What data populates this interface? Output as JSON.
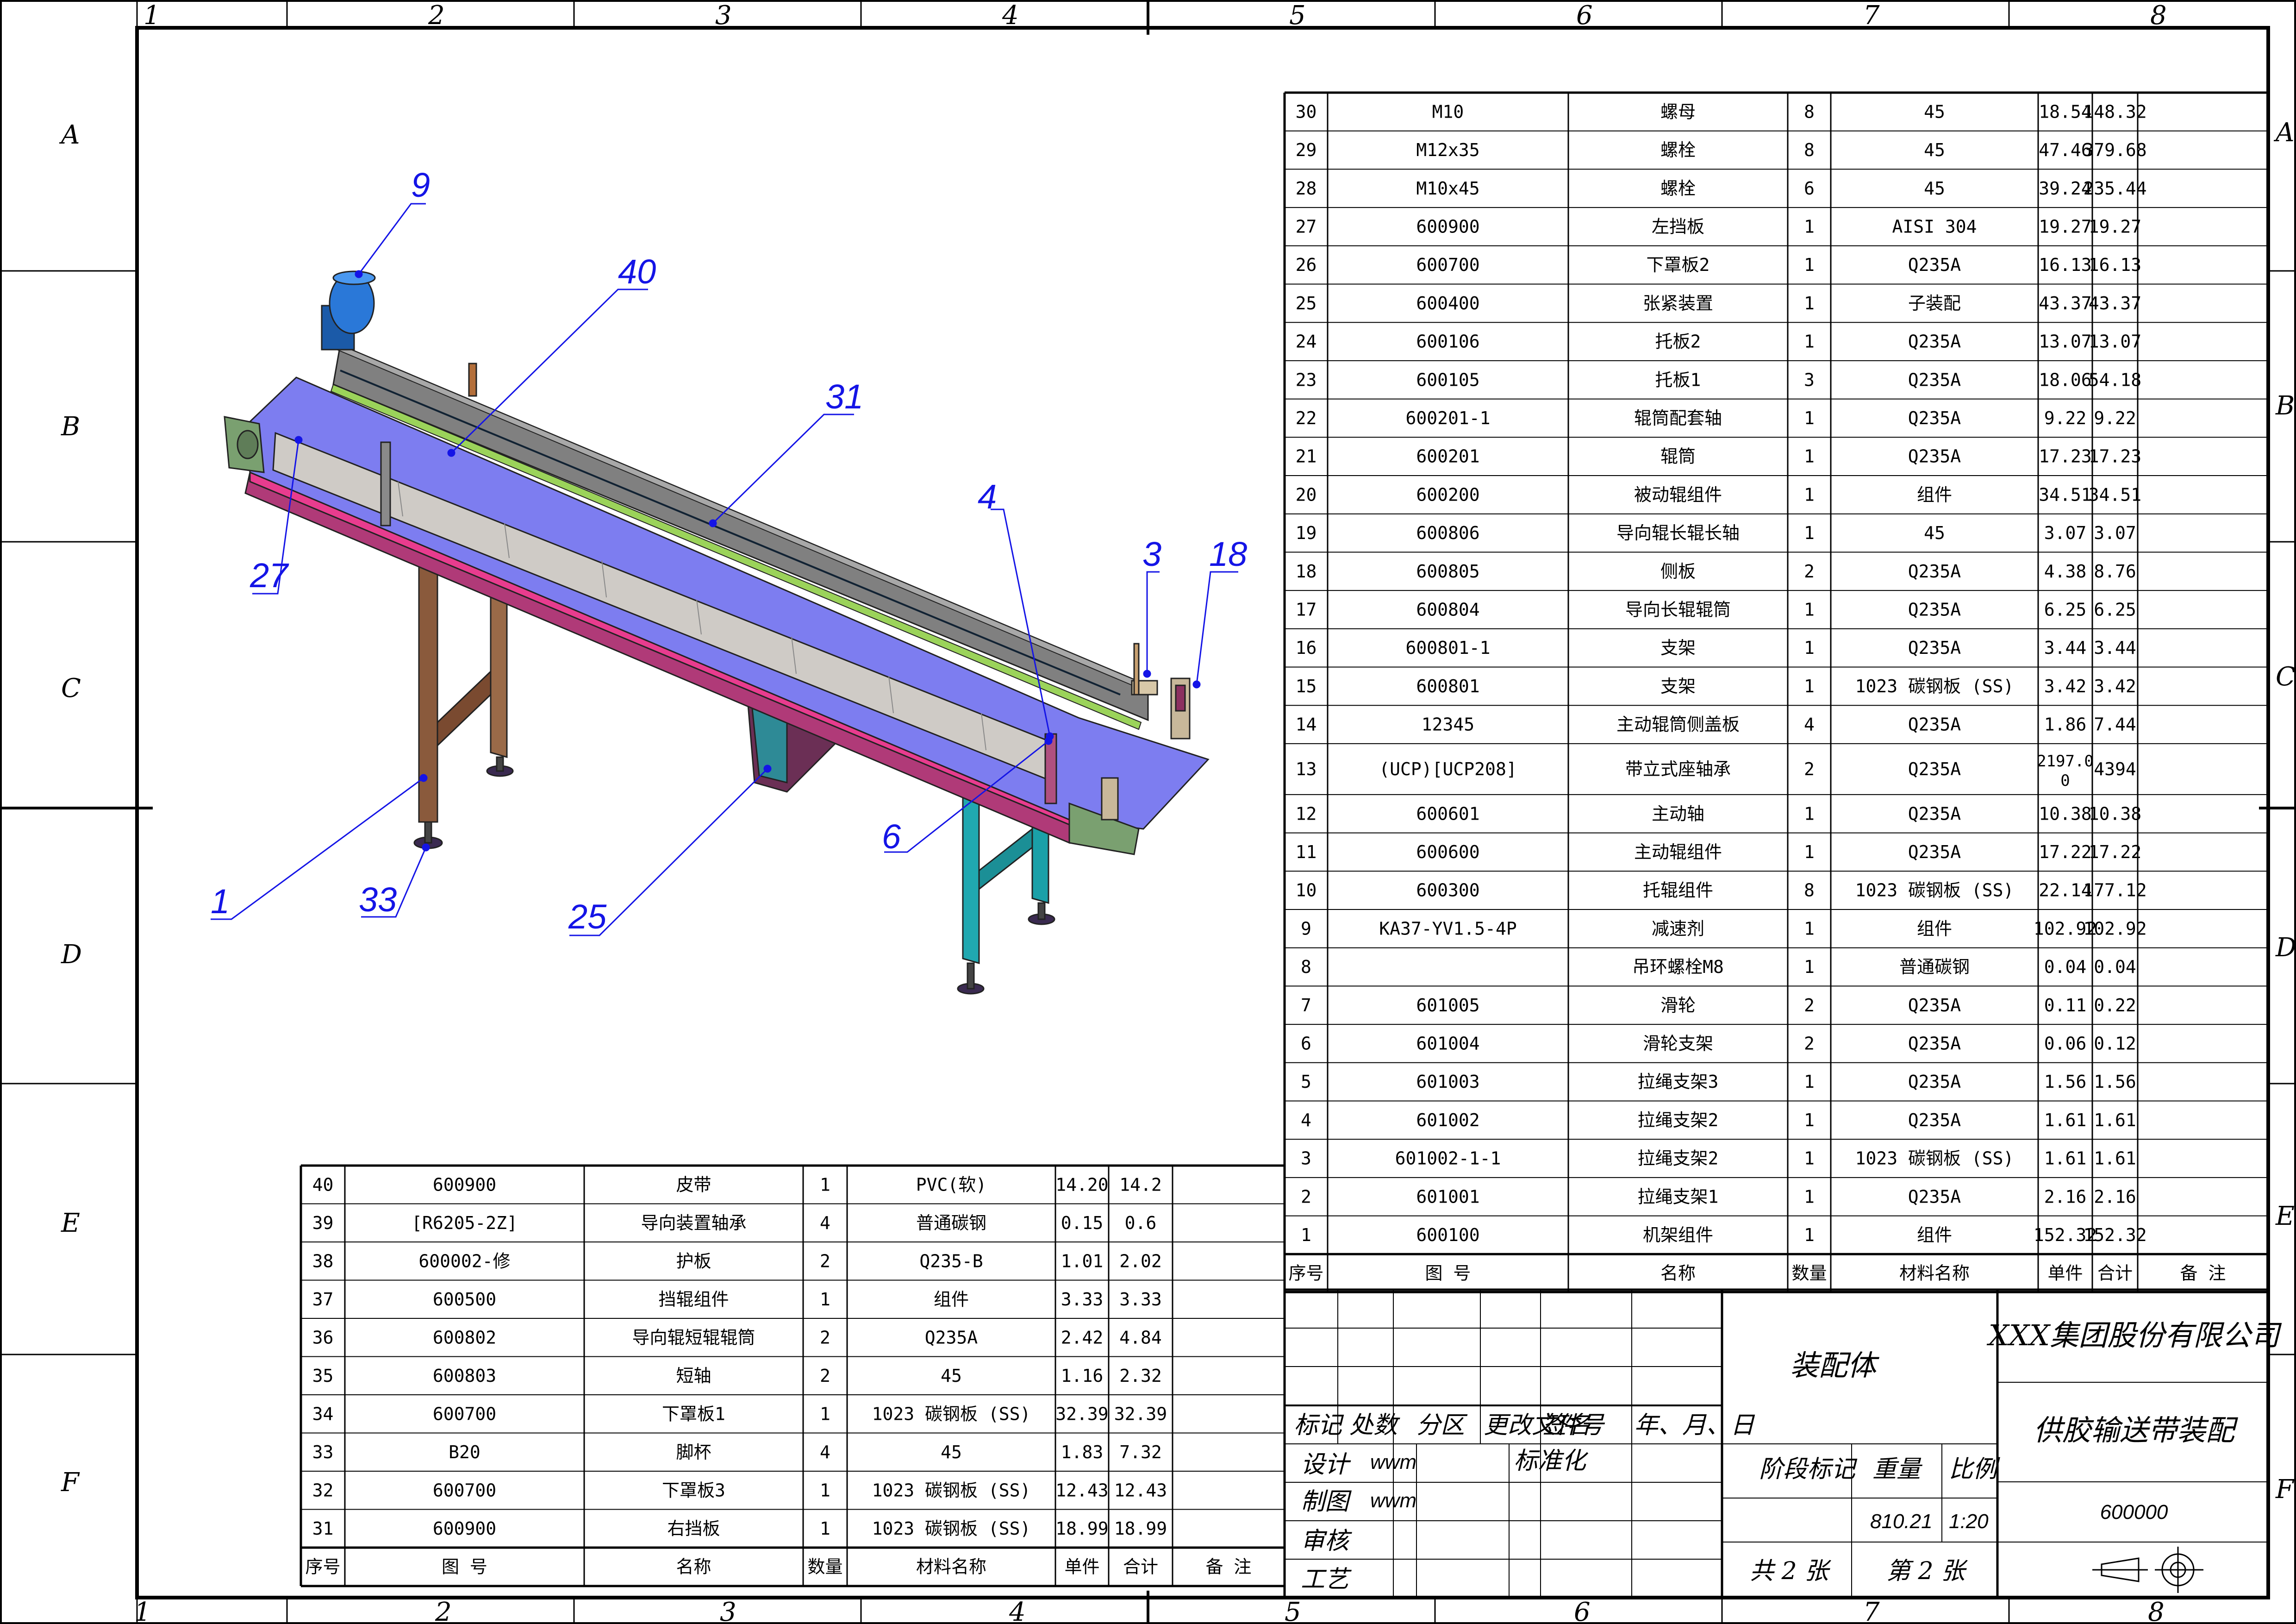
{
  "zones": {
    "columns": [
      "1",
      "2",
      "3",
      "4",
      "5",
      "6",
      "7",
      "8"
    ],
    "rows": [
      "A",
      "B",
      "C",
      "D",
      "E",
      "F"
    ]
  },
  "balloons": [
    "9",
    "40",
    "31",
    "27",
    "4",
    "3",
    "18",
    "6",
    "1",
    "33",
    "25"
  ],
  "bom_headers": {
    "no": "序号",
    "code": "图 号",
    "name": "名称",
    "qty": "数量",
    "material": "材料名称",
    "unit": "单件",
    "total": "合计",
    "remark": "备 注"
  },
  "bom_right": [
    {
      "no": "30",
      "code": "M10",
      "name": "螺母",
      "qty": "8",
      "material": "45",
      "unit": "18.54",
      "total": "148.32"
    },
    {
      "no": "29",
      "code": "M12x35",
      "name": "螺栓",
      "qty": "8",
      "material": "45",
      "unit": "47.46",
      "total": "379.68"
    },
    {
      "no": "28",
      "code": "M10x45",
      "name": "螺栓",
      "qty": "6",
      "material": "45",
      "unit": "39.24",
      "total": "235.44"
    },
    {
      "no": "27",
      "code": "600900",
      "name": "左挡板",
      "qty": "1",
      "material": "AISI 304",
      "unit": "19.27",
      "total": "19.27"
    },
    {
      "no": "26",
      "code": "600700",
      "name": "下罩板2",
      "qty": "1",
      "material": "Q235A",
      "unit": "16.13",
      "total": "16.13"
    },
    {
      "no": "25",
      "code": "600400",
      "name": "张紧装置",
      "qty": "1",
      "material": "子装配",
      "unit": "43.37",
      "total": "43.37"
    },
    {
      "no": "24",
      "code": "600106",
      "name": "托板2",
      "qty": "1",
      "material": "Q235A",
      "unit": "13.07",
      "total": "13.07"
    },
    {
      "no": "23",
      "code": "600105",
      "name": "托板1",
      "qty": "3",
      "material": "Q235A",
      "unit": "18.06",
      "total": "54.18"
    },
    {
      "no": "22",
      "code": "600201-1",
      "name": "辊筒配套轴",
      "qty": "1",
      "material": "Q235A",
      "unit": "9.22",
      "total": "9.22"
    },
    {
      "no": "21",
      "code": "600201",
      "name": "辊筒",
      "qty": "1",
      "material": "Q235A",
      "unit": "17.23",
      "total": "17.23"
    },
    {
      "no": "20",
      "code": "600200",
      "name": "被动辊组件",
      "qty": "1",
      "material": "组件",
      "unit": "34.51",
      "total": "34.51"
    },
    {
      "no": "19",
      "code": "600806",
      "name": "导向辊长辊长轴",
      "qty": "1",
      "material": "45",
      "unit": "3.07",
      "total": "3.07"
    },
    {
      "no": "18",
      "code": "600805",
      "name": "侧板",
      "qty": "2",
      "material": "Q235A",
      "unit": "4.38",
      "total": "8.76"
    },
    {
      "no": "17",
      "code": "600804",
      "name": "导向长辊辊筒",
      "qty": "1",
      "material": "Q235A",
      "unit": "6.25",
      "total": "6.25"
    },
    {
      "no": "16",
      "code": "600801-1",
      "name": "支架",
      "qty": "1",
      "material": "Q235A",
      "unit": "3.44",
      "total": "3.44"
    },
    {
      "no": "15",
      "code": "600801",
      "name": "支架",
      "qty": "1",
      "material": "1023 碳钢板 (SS)",
      "unit": "3.42",
      "total": "3.42"
    },
    {
      "no": "14",
      "code": "12345",
      "name": "主动辊筒侧盖板",
      "qty": "4",
      "material": "Q235A",
      "unit": "1.86",
      "total": "7.44"
    },
    {
      "no": "13",
      "code": "(UCP)[UCP208]",
      "name": "带立式座轴承",
      "qty": "2",
      "material": "Q235A",
      "unit": "2197.0",
      "unit2": "0",
      "total": "4394"
    },
    {
      "no": "12",
      "code": "600601",
      "name": "主动轴",
      "qty": "1",
      "material": "Q235A",
      "unit": "10.38",
      "total": "10.38"
    },
    {
      "no": "11",
      "code": "600600",
      "name": "主动辊组件",
      "qty": "1",
      "material": "Q235A",
      "unit": "17.22",
      "total": "17.22"
    },
    {
      "no": "10",
      "code": "600300",
      "name": "托辊组件",
      "qty": "8",
      "material": "1023 碳钢板 (SS)",
      "unit": "22.14",
      "total": "177.12"
    },
    {
      "no": "9",
      "code": "KA37-YV1.5-4P",
      "name": "减速剂",
      "qty": "1",
      "material": "组件",
      "unit": "102.92",
      "total": "102.92"
    },
    {
      "no": "8",
      "code": "",
      "name": "吊环螺栓M8",
      "qty": "1",
      "material": "普通碳钢",
      "unit": "0.04",
      "total": "0.04"
    },
    {
      "no": "7",
      "code": "601005",
      "name": "滑轮",
      "qty": "2",
      "material": "Q235A",
      "unit": "0.11",
      "total": "0.22"
    },
    {
      "no": "6",
      "code": "601004",
      "name": "滑轮支架",
      "qty": "2",
      "material": "Q235A",
      "unit": "0.06",
      "total": "0.12"
    },
    {
      "no": "5",
      "code": "601003",
      "name": "拉绳支架3",
      "qty": "1",
      "material": "Q235A",
      "unit": "1.56",
      "total": "1.56"
    },
    {
      "no": "4",
      "code": "601002",
      "name": "拉绳支架2",
      "qty": "1",
      "material": "Q235A",
      "unit": "1.61",
      "total": "1.61"
    },
    {
      "no": "3",
      "code": "601002-1-1",
      "name": "拉绳支架2",
      "qty": "1",
      "material": "1023 碳钢板 (SS)",
      "unit": "1.61",
      "total": "1.61"
    },
    {
      "no": "2",
      "code": "601001",
      "name": "拉绳支架1",
      "qty": "1",
      "material": "Q235A",
      "unit": "2.16",
      "total": "2.16"
    },
    {
      "no": "1",
      "code": "600100",
      "name": "机架组件",
      "qty": "1",
      "material": "组件",
      "unit": "152.32",
      "total": "152.32"
    }
  ],
  "bom_left": [
    {
      "no": "40",
      "code": "600900",
      "name": "皮带",
      "qty": "1",
      "material": "PVC(软)",
      "unit": "14.20",
      "total": "14.2"
    },
    {
      "no": "39",
      "code": "[R6205-2Z]",
      "name": "导向装置轴承",
      "qty": "4",
      "material": "普通碳钢",
      "unit": "0.15",
      "total": "0.6"
    },
    {
      "no": "38",
      "code": "600002-修",
      "name": "护板",
      "qty": "2",
      "material": "Q235-B",
      "unit": "1.01",
      "total": "2.02"
    },
    {
      "no": "37",
      "code": "600500",
      "name": "挡辊组件",
      "qty": "1",
      "material": "组件",
      "unit": "3.33",
      "total": "3.33"
    },
    {
      "no": "36",
      "code": "600802",
      "name": "导向辊短辊辊筒",
      "qty": "2",
      "material": "Q235A",
      "unit": "2.42",
      "total": "4.84"
    },
    {
      "no": "35",
      "code": "600803",
      "name": "短轴",
      "qty": "2",
      "material": "45",
      "unit": "1.16",
      "total": "2.32"
    },
    {
      "no": "34",
      "code": "600700",
      "name": "下罩板1",
      "qty": "1",
      "material": "1023 碳钢板 (SS)",
      "unit": "32.39",
      "total": "32.39"
    },
    {
      "no": "33",
      "code": "B20",
      "name": "脚杯",
      "qty": "4",
      "material": "45",
      "unit": "1.83",
      "total": "7.32"
    },
    {
      "no": "32",
      "code": "600700",
      "name": "下罩板3",
      "qty": "1",
      "material": "1023 碳钢板 (SS)",
      "unit": "12.43",
      "total": "12.43"
    },
    {
      "no": "31",
      "code": "600900",
      "name": "右挡板",
      "qty": "1",
      "material": "1023 碳钢板 (SS)",
      "unit": "18.99",
      "total": "18.99"
    }
  ],
  "title_block": {
    "mark": "标记",
    "count": "处数",
    "zone": "分区",
    "change_doc": "更改文件号",
    "signature": "签名",
    "date": "年、月、日",
    "design": "设计",
    "drafting": "制图",
    "review": "审核",
    "process": "工艺",
    "designer": "wwm",
    "drafter": "wwm",
    "standardize": "标准化",
    "type": "装配体",
    "stage_mark": "阶段标记",
    "weight": "重量",
    "scale": "比例",
    "weight_value": "810.21",
    "scale_value": "1:20",
    "sheets_total": "共  2  张",
    "sheet_no": "第  2  张",
    "company": "XXX集团股份有限公司",
    "drawing_title": "供胶输送带装配",
    "drawing_no": "600000"
  }
}
